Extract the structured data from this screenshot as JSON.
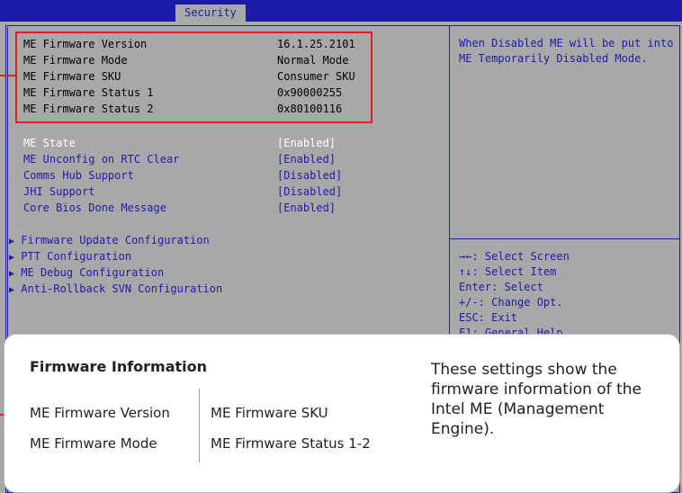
{
  "tabs": {
    "active": "Security"
  },
  "firmware_info": [
    {
      "label": "ME Firmware Version",
      "value": "16.1.25.2101"
    },
    {
      "label": "ME Firmware Mode",
      "value": "Normal Mode"
    },
    {
      "label": "ME Firmware SKU",
      "value": "Consumer SKU"
    },
    {
      "label": "ME Firmware Status 1",
      "value": "0x90000255"
    },
    {
      "label": "ME Firmware Status 2",
      "value": "0x80100116"
    }
  ],
  "settings": [
    {
      "label": "ME State",
      "value": "[Enabled]"
    },
    {
      "label": "ME Unconfig on RTC Clear",
      "value": "[Enabled]"
    },
    {
      "label": "Comms Hub Support",
      "value": "[Disabled]"
    },
    {
      "label": "JHI Support",
      "value": "[Disabled]"
    },
    {
      "label": "Core Bios Done Message",
      "value": "[Enabled]"
    }
  ],
  "submenus": [
    "Firmware Update Configuration",
    "PTT Configuration",
    "ME Debug Configuration",
    "Anti-Rollback SVN Configuration"
  ],
  "help_text": "When Disabled ME will be put into ME Temporarily Disabled Mode.",
  "key_help": [
    "→←: Select Screen",
    "↑↓: Select Item",
    "Enter: Select",
    "+/-: Change Opt.",
    "ESC: Exit",
    "F1: General Help"
  ],
  "card": {
    "title": "Firmware Information",
    "items": [
      "ME Firmware Version",
      "ME Firmware SKU",
      "ME Firmware Mode",
      "ME Firmware Status 1-2"
    ],
    "description": "These settings show the firmware information of the Intel ME (Management Engine)."
  },
  "colors": {
    "bios_bg": "#a8a8a8",
    "bios_blue": "#1c1ca8",
    "highlight": "#e02020"
  }
}
